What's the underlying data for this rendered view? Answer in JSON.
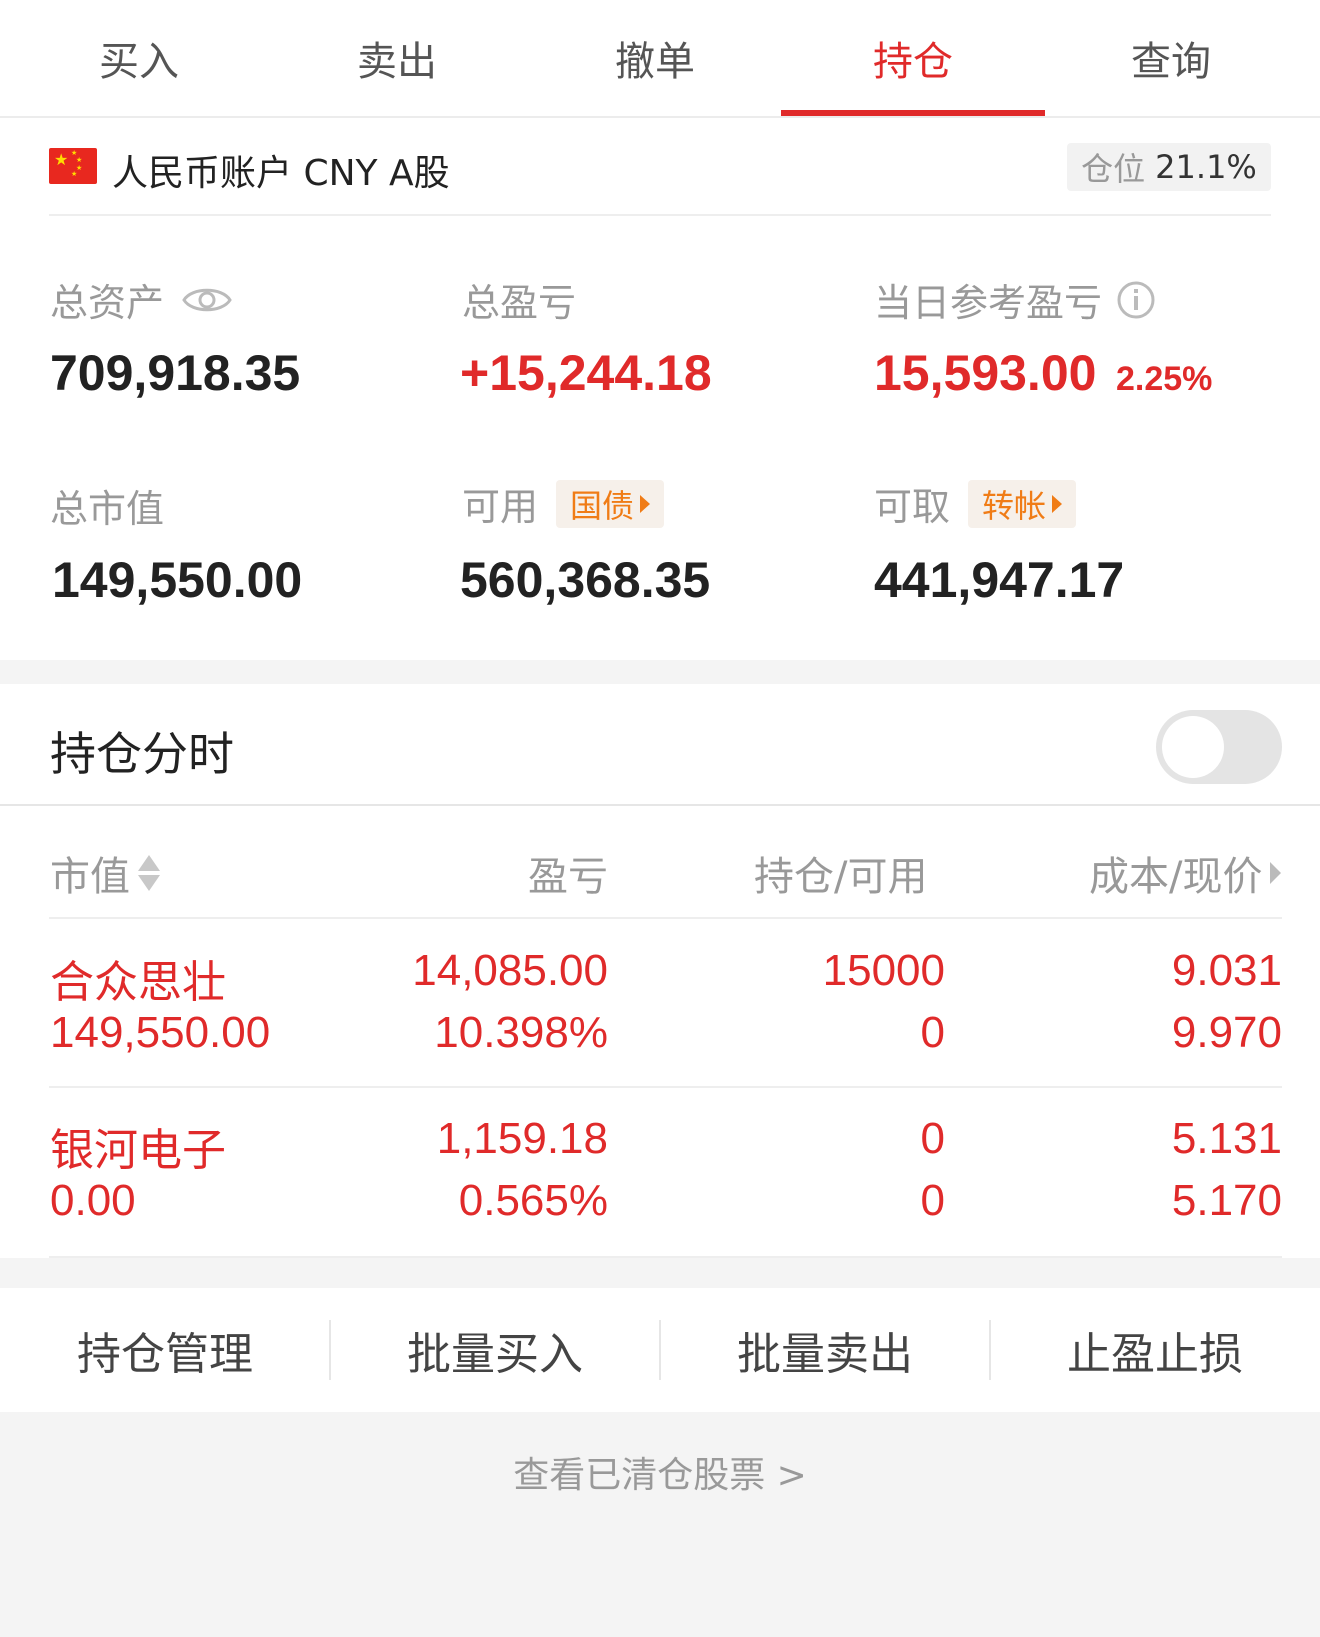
{
  "tabs": [
    "买入",
    "卖出",
    "撤单",
    "持仓",
    "查询"
  ],
  "active_tab": "持仓",
  "account": {
    "name": "人民币账户 CNY A股",
    "position_label": "仓位",
    "position_value": "21.1%"
  },
  "metrics": {
    "total_assets_label": "总资产",
    "total_assets": "709,918.35",
    "total_pnl_label": "总盈亏",
    "total_pnl": "+15,244.18",
    "daily_pnl_label": "当日参考盈亏",
    "daily_pnl": "15,593.00",
    "daily_pnl_pct": "2.25%",
    "market_value_label": "总市值",
    "market_value": "149,550.00",
    "available_label": "可用",
    "available_tag": "国债",
    "available": "560,368.35",
    "withdrawable_label": "可取",
    "withdrawable_tag": "转帐",
    "withdrawable": "441,947.17"
  },
  "fenshi": {
    "title": "持仓分时",
    "enabled": false
  },
  "table": {
    "headers": {
      "market_value": "市值",
      "pnl": "盈亏",
      "position": "持仓/可用",
      "cost": "成本/现价"
    },
    "rows": [
      {
        "name": "合众思壮",
        "market_value": "149,550.00",
        "pnl": "14,085.00",
        "pnl_pct": "10.398%",
        "position": "15000",
        "available": "0",
        "cost": "9.031",
        "price": "9.970"
      },
      {
        "name": "银河电子",
        "market_value": "0.00",
        "pnl": "1,159.18",
        "pnl_pct": "0.565%",
        "position": "0",
        "available": "0",
        "cost": "5.131",
        "price": "5.170"
      }
    ]
  },
  "actions": [
    "持仓管理",
    "批量买入",
    "批量卖出",
    "止盈止损"
  ],
  "cleared_link": "查看已清仓股票 >",
  "colors": {
    "accent_red": "#e02a2a",
    "orange": "#f07c16"
  },
  "icons": {
    "eye": "eye-icon",
    "info": "info-icon",
    "flag": "china-flag-icon"
  }
}
